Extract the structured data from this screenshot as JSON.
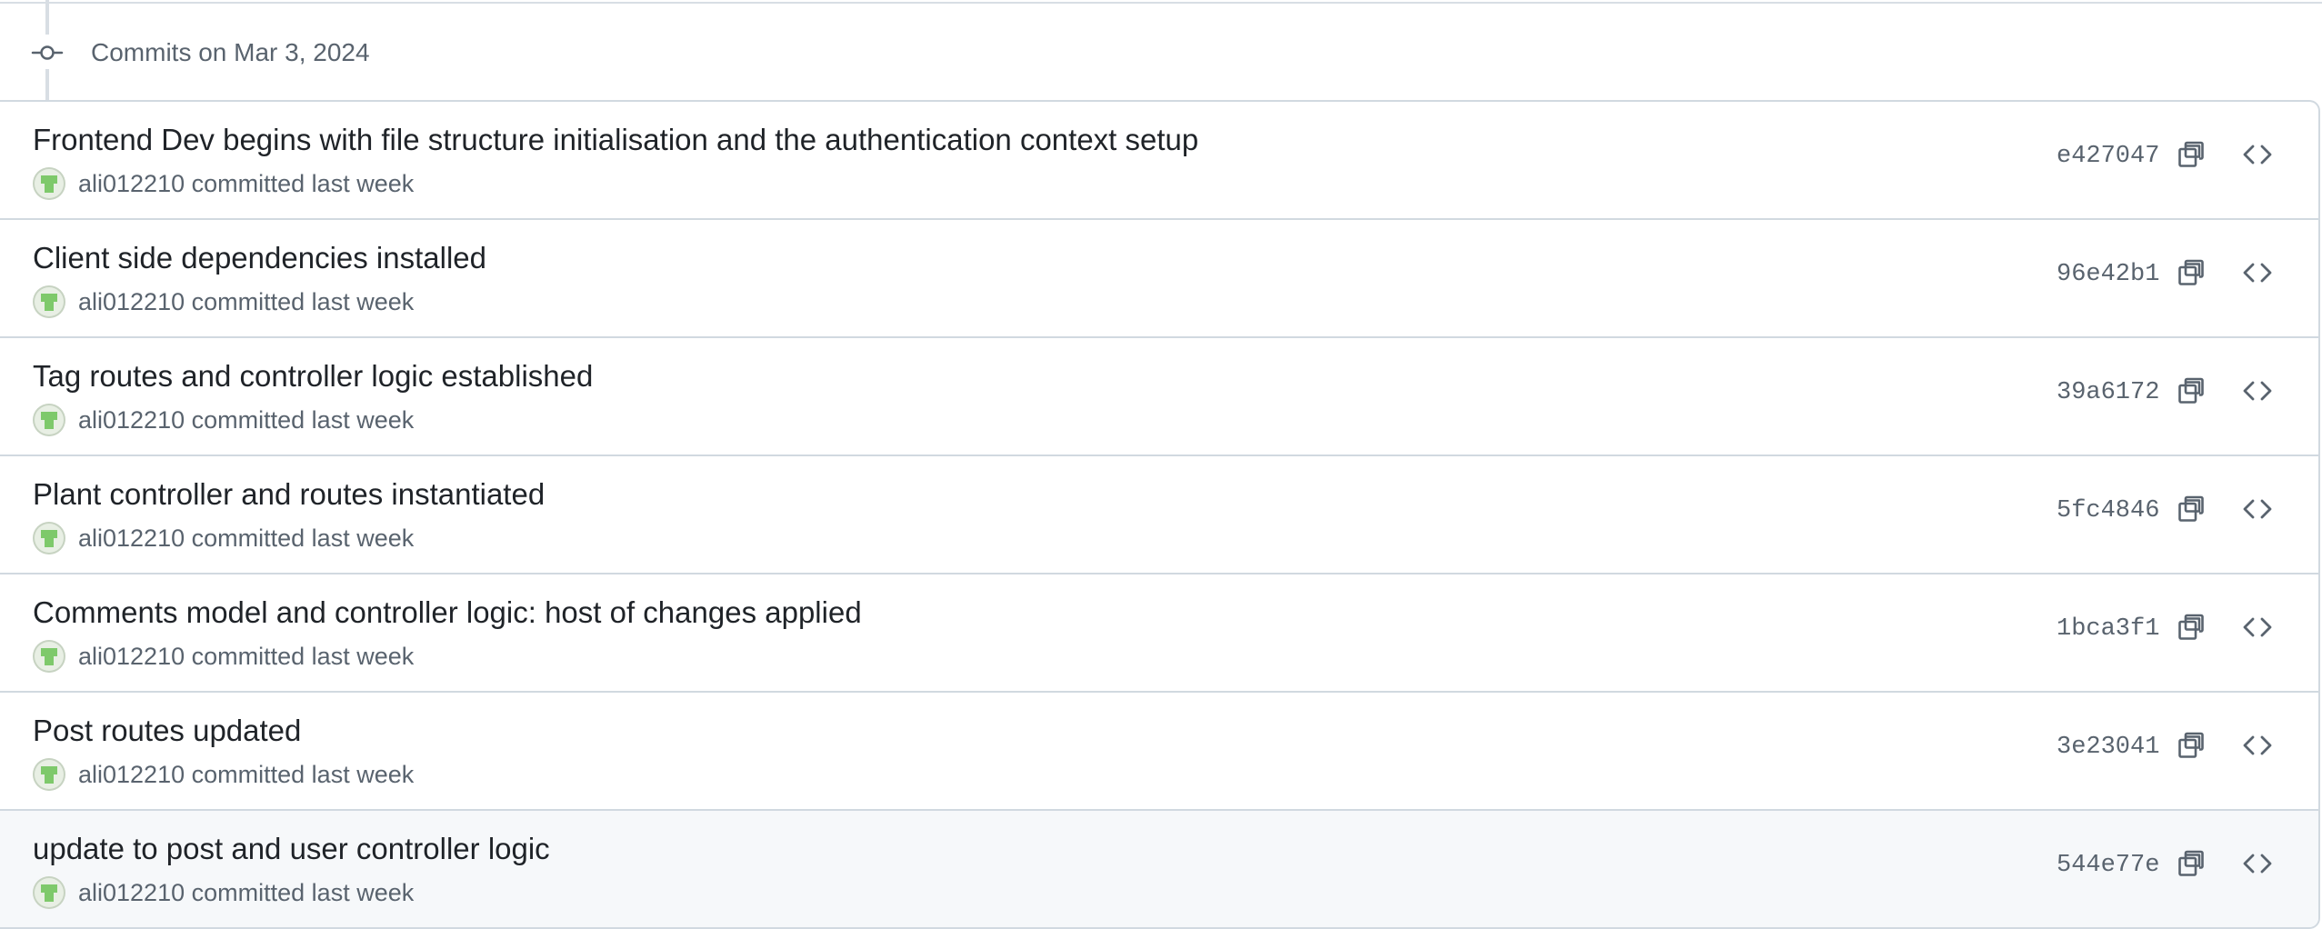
{
  "group": {
    "title": "Commits on Mar 3, 2024",
    "icon": "git-commit-icon"
  },
  "commits": [
    {
      "title": "Frontend Dev begins with file structure initialisation and the authentication context setup",
      "author": "ali012210",
      "action": "committed last week",
      "sha": "e427047"
    },
    {
      "title": "Client side dependencies installed",
      "author": "ali012210",
      "action": "committed last week",
      "sha": "96e42b1"
    },
    {
      "title": "Tag routes and controller logic established",
      "author": "ali012210",
      "action": "committed last week",
      "sha": "39a6172"
    },
    {
      "title": "Plant controller and routes instantiated",
      "author": "ali012210",
      "action": "committed last week",
      "sha": "5fc4846"
    },
    {
      "title": "Comments model and controller logic: host of changes applied",
      "author": "ali012210",
      "action": "committed last week",
      "sha": "1bca3f1"
    },
    {
      "title": "Post routes updated",
      "author": "ali012210",
      "action": "committed last week",
      "sha": "3e23041"
    },
    {
      "title": "update to post and user controller logic",
      "author": "ali012210",
      "action": "committed last week",
      "sha": "544e77e"
    }
  ],
  "icons": {
    "copy": "copy-icon",
    "browse": "code-icon",
    "avatar": "identicon-avatar"
  },
  "colors": {
    "border": "#d1d9e0",
    "muted_text": "#59636e",
    "hover_row": "#f6f8fa",
    "avatar_green": "#7ec96b"
  }
}
